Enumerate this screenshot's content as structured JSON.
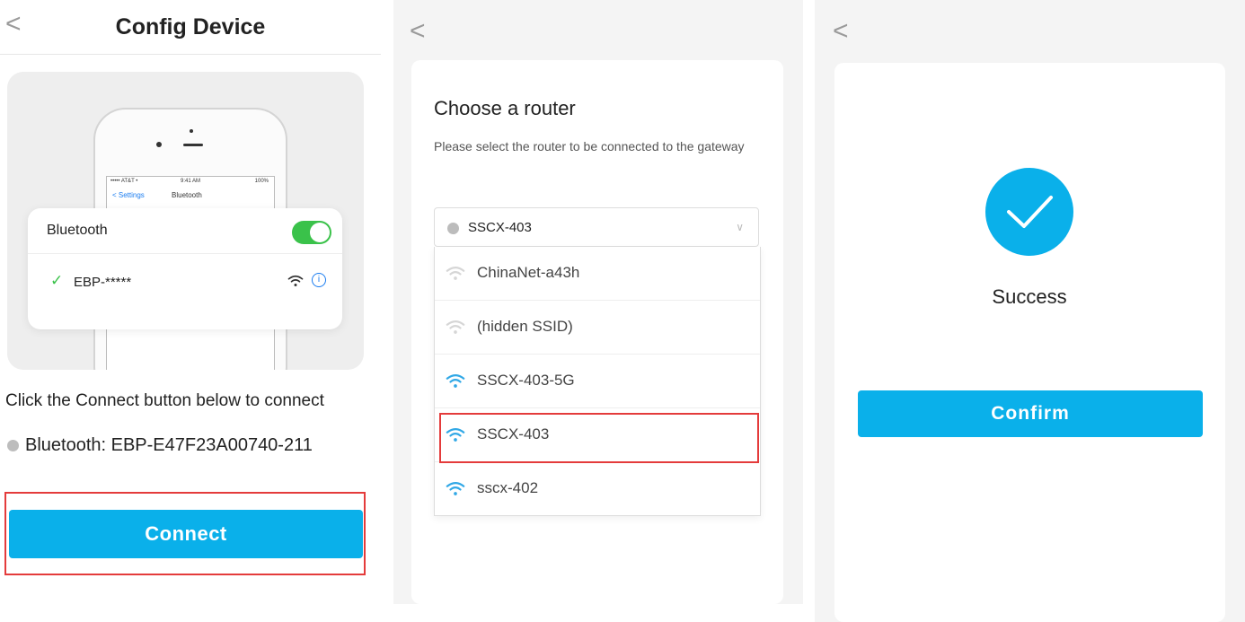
{
  "panel1": {
    "back_glyph": "<",
    "title": "Config Device",
    "illustration": {
      "carrier": "••••• AT&T •",
      "time": "9:41 AM",
      "battery": "100%",
      "settings_link": "< Settings",
      "nav_title": "Bluetooth",
      "bt_label": "Bluetooth",
      "toggle_on": true,
      "device": "EBP-*****",
      "check_glyph": "✓",
      "info_glyph": "i"
    },
    "instruction": "Click the Connect button below to connect",
    "bluetooth_device": "Bluetooth: EBP-E47F23A00740-211",
    "connect_label": "Connect"
  },
  "panel2": {
    "back_glyph": "<",
    "title": "Choose a router",
    "subtitle": "Please select the router to be connected to the gateway",
    "selected": "SSCX-403",
    "chevron": "∨",
    "options": [
      {
        "label": "ChinaNet-a43h",
        "strength": "weak"
      },
      {
        "label": "(hidden SSID)",
        "strength": "weak"
      },
      {
        "label": "SSCX-403-5G",
        "strength": "strong"
      },
      {
        "label": "SSCX-403",
        "strength": "strong"
      },
      {
        "label": "sscx-402",
        "strength": "strong"
      }
    ]
  },
  "panel3": {
    "back_glyph": "<",
    "status": "Success",
    "confirm_label": "Confirm"
  },
  "colors": {
    "accent": "#0ab0ea",
    "highlight_border": "#e43b3b",
    "toggle_on": "#3ac24a",
    "wifi_strong": "#31a8e6",
    "wifi_weak": "#d6d6d6"
  }
}
